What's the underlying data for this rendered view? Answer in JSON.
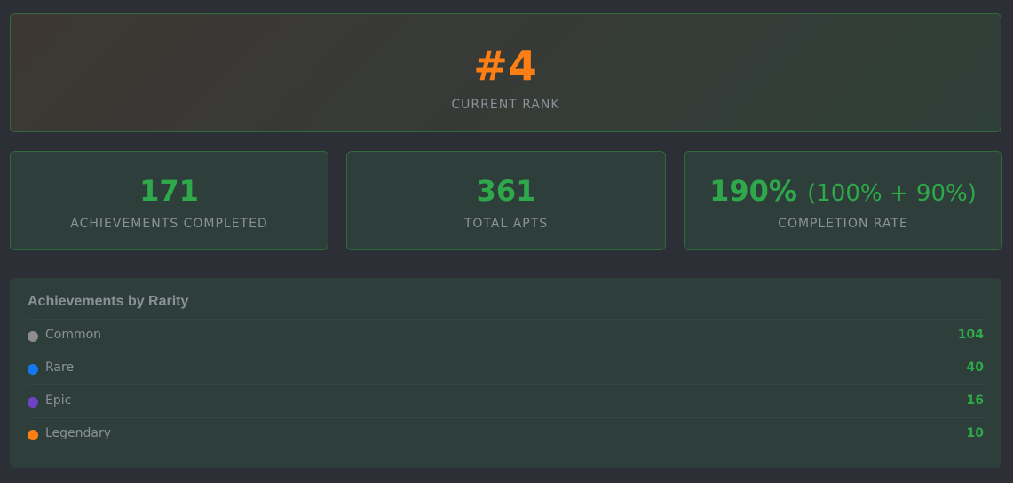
{
  "rank": {
    "value": "#4",
    "label": "CURRENT RANK"
  },
  "stats": [
    {
      "value": "171",
      "sub": "",
      "label": "ACHIEVEMENTS COMPLETED"
    },
    {
      "value": "361",
      "sub": "",
      "label": "TOTAL APTS"
    },
    {
      "value": "190%",
      "sub": "(100% + 90%)",
      "label": "COMPLETION RATE"
    }
  ],
  "rarity": {
    "title": "Achievements by Rarity",
    "items": [
      {
        "name": "Common",
        "count": "104",
        "color": "#8d8d8d"
      },
      {
        "name": "Rare",
        "count": "40",
        "color": "#1479f0"
      },
      {
        "name": "Epic",
        "count": "16",
        "color": "#6f42c1"
      },
      {
        "name": "Legendary",
        "count": "10",
        "color": "#fd7e14"
      }
    ]
  },
  "colors": {
    "accent_orange": "#fd7e14",
    "accent_green": "#2ea84a",
    "background": "#2c3036"
  }
}
